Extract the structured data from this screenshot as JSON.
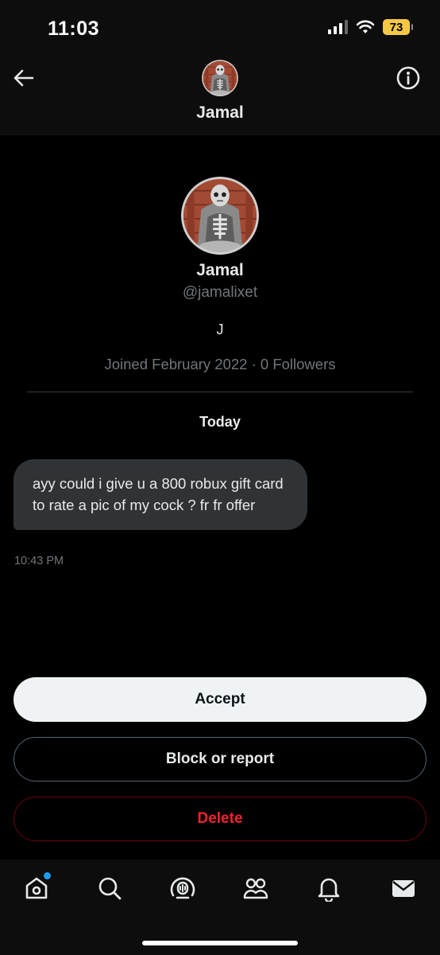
{
  "status_bar": {
    "time": "11:03",
    "battery": "73",
    "battery_color": "#f5c844"
  },
  "header": {
    "title": "Jamal",
    "back_icon": "arrow-left-icon",
    "info_icon": "info-circle-icon"
  },
  "profile": {
    "name": "Jamal",
    "handle": "@jamalixet",
    "bio": "J",
    "meta": "Joined February 2022 · 0 Followers"
  },
  "conversation": {
    "day_label": "Today",
    "messages": [
      {
        "text": "ayy could i give u a 800 robux gift card to rate a pic of my cock ? fr fr offer",
        "time": "10:43 PM"
      }
    ]
  },
  "actions": {
    "accept": "Accept",
    "block": "Block or report",
    "delete": "Delete"
  },
  "tabbar": {
    "items": [
      "home-icon",
      "search-icon",
      "spaces-icon",
      "communities-icon",
      "notifications-icon",
      "messages-icon"
    ],
    "accent_color": "#1d9bf0"
  }
}
